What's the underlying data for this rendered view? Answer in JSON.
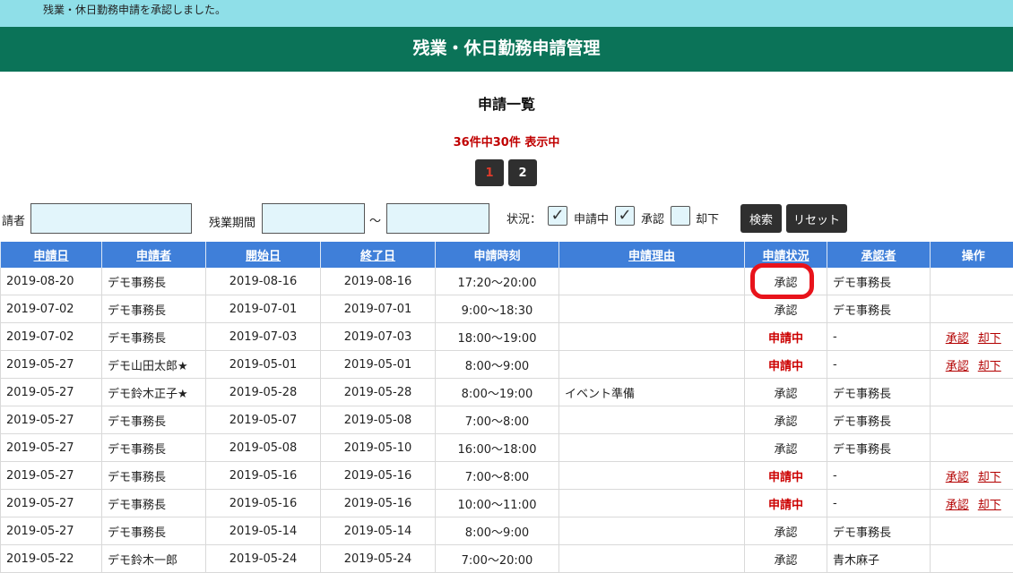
{
  "notice": {
    "message": "残業・休日勤務申請を承認しました。"
  },
  "header": {
    "title": "残業・休日勤務申請管理"
  },
  "list": {
    "title": "申請一覧",
    "count_text": "36件中30件 表示中",
    "pages": [
      "1",
      "2"
    ],
    "current_page": "1"
  },
  "search": {
    "applicant_label": "請者",
    "applicant_value": "",
    "period_label": "残業期間",
    "period_from": "",
    "period_tilde": "～",
    "period_to": "",
    "status_label": "状況：",
    "status_options": [
      {
        "label": "申請中",
        "checked": true
      },
      {
        "label": "承認",
        "checked": true
      },
      {
        "label": "却下",
        "checked": false
      }
    ],
    "search_button": "検索",
    "reset_button": "リセット"
  },
  "colors": {
    "header_bg": "#0b7358",
    "table_header_bg": "#3f7fd9",
    "notice_bg": "#8fdfe8",
    "pending": "#cc0000",
    "highlight": "#e8131b"
  },
  "table": {
    "columns": [
      "申請日",
      "申請者",
      "開始日",
      "終了日",
      "申請時刻",
      "申請理由",
      "申請状況",
      "承認者",
      "操作"
    ],
    "action_labels": {
      "approve": "承認",
      "reject": "却下"
    },
    "rows": [
      {
        "date": "2019-08-20",
        "applicant": "デモ事務長",
        "start": "2019-08-16",
        "end": "2019-08-16",
        "time": "17:20～20:00",
        "reason": "",
        "status": "承認",
        "approver": "デモ事務長",
        "actions": false
      },
      {
        "date": "2019-07-02",
        "applicant": "デモ事務長",
        "start": "2019-07-01",
        "end": "2019-07-01",
        "time": "9:00～18:30",
        "reason": "",
        "status": "承認",
        "approver": "デモ事務長",
        "actions": false
      },
      {
        "date": "2019-07-02",
        "applicant": "デモ事務長",
        "start": "2019-07-03",
        "end": "2019-07-03",
        "time": "18:00～19:00",
        "reason": "",
        "status": "申請中",
        "approver": "-",
        "actions": true
      },
      {
        "date": "2019-05-27",
        "applicant": "デモ山田太郎★",
        "start": "2019-05-01",
        "end": "2019-05-01",
        "time": "8:00～9:00",
        "reason": "",
        "status": "申請中",
        "approver": "-",
        "actions": true
      },
      {
        "date": "2019-05-27",
        "applicant": "デモ鈴木正子★",
        "start": "2019-05-28",
        "end": "2019-05-28",
        "time": "8:00～19:00",
        "reason": "イベント準備",
        "status": "承認",
        "approver": "デモ事務長",
        "actions": false
      },
      {
        "date": "2019-05-27",
        "applicant": "デモ事務長",
        "start": "2019-05-07",
        "end": "2019-05-08",
        "time": "7:00～8:00",
        "reason": "",
        "status": "承認",
        "approver": "デモ事務長",
        "actions": false
      },
      {
        "date": "2019-05-27",
        "applicant": "デモ事務長",
        "start": "2019-05-08",
        "end": "2019-05-10",
        "time": "16:00～18:00",
        "reason": "",
        "status": "承認",
        "approver": "デモ事務長",
        "actions": false
      },
      {
        "date": "2019-05-27",
        "applicant": "デモ事務長",
        "start": "2019-05-16",
        "end": "2019-05-16",
        "time": "7:00～8:00",
        "reason": "",
        "status": "申請中",
        "approver": "-",
        "actions": true
      },
      {
        "date": "2019-05-27",
        "applicant": "デモ事務長",
        "start": "2019-05-16",
        "end": "2019-05-16",
        "time": "10:00～11:00",
        "reason": "",
        "status": "申請中",
        "approver": "-",
        "actions": true
      },
      {
        "date": "2019-05-27",
        "applicant": "デモ事務長",
        "start": "2019-05-14",
        "end": "2019-05-14",
        "time": "8:00～9:00",
        "reason": "",
        "status": "承認",
        "approver": "デモ事務長",
        "actions": false
      },
      {
        "date": "2019-05-22",
        "applicant": "デモ鈴木一郎",
        "start": "2019-05-24",
        "end": "2019-05-24",
        "time": "7:00～20:00",
        "reason": "",
        "status": "承認",
        "approver": "青木麻子",
        "actions": false
      }
    ]
  }
}
